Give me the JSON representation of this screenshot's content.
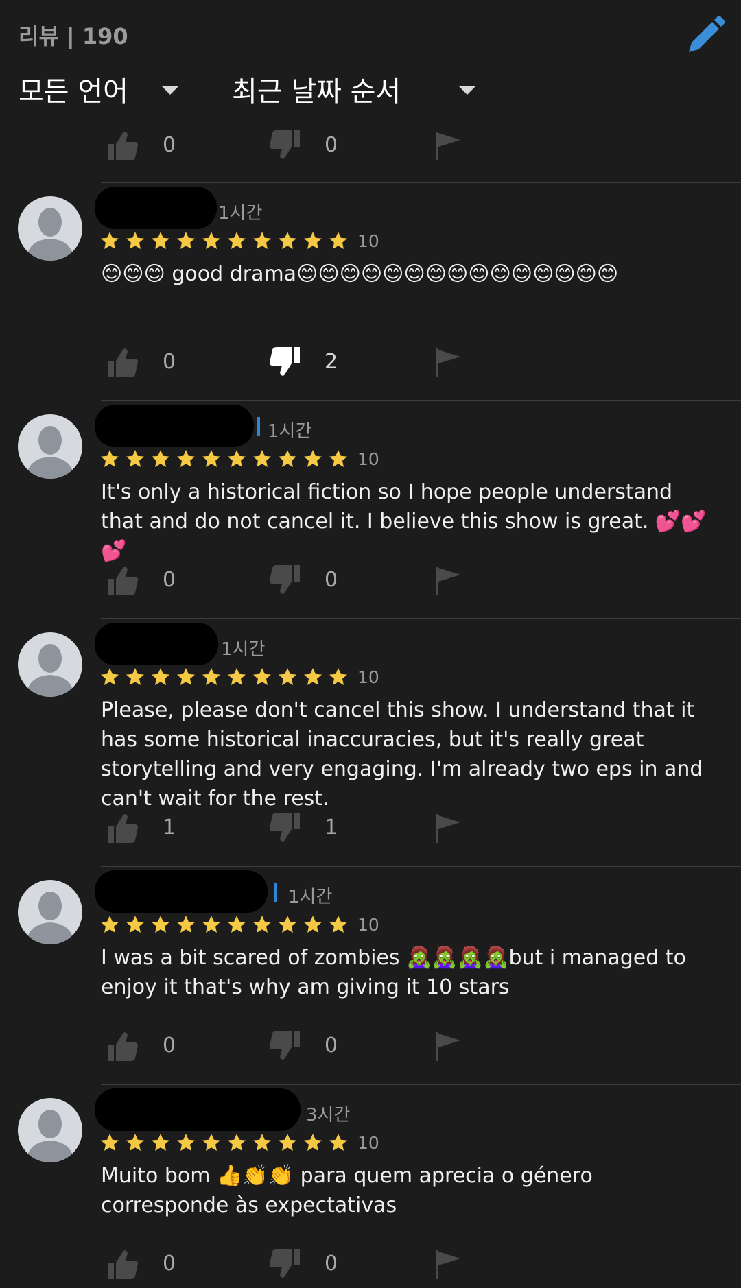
{
  "header": {
    "review_count_label": "리뷰 | 190",
    "edit_icon": "pencil-icon",
    "language_filter": "모든 언어",
    "sort_filter": "최근 날짜 순서"
  },
  "top_actions": {
    "likes": "0",
    "dislikes": "0"
  },
  "reviews": [
    {
      "time": "1시간",
      "rating_stars": 10,
      "score": "10",
      "text": "😊😊😊 good drama😊😊😊😊😊😊😊😊😊😊😊😊😊😊😊",
      "likes": "0",
      "dislikes": "2",
      "dislike_active": true
    },
    {
      "time": "1시간",
      "rating_stars": 10,
      "score": "10",
      "text": "It's only a historical fiction so I hope people understand that and do not cancel it. I believe this show is great. 💕💕💕",
      "likes": "0",
      "dislikes": "0",
      "dislike_active": false
    },
    {
      "time": "1시간",
      "rating_stars": 10,
      "score": "10",
      "text": "Please, please don't cancel this show. I understand that it has some historical inaccuracies, but it's really great storytelling and very engaging. I'm already two eps in and can't wait for the rest.",
      "likes": "1",
      "dislikes": "1",
      "dislike_active": false
    },
    {
      "time": "1시간",
      "rating_stars": 10,
      "score": "10",
      "text": "I was a bit scared of zombies 🧟‍♀️🧟‍♀️🧟‍♀️🧟‍♀️but i managed to enjoy it that's why am giving it 10 stars",
      "likes": "0",
      "dislikes": "0",
      "dislike_active": false
    },
    {
      "time": "3시간",
      "rating_stars": 10,
      "score": "10",
      "text": "Muito bom 👍👏👏 para quem aprecia o género corresponde às expectativas",
      "likes": "0",
      "dislikes": "0",
      "dislike_active": false
    }
  ],
  "colors": {
    "background": "#1c1c1c",
    "star": "#f6c945",
    "edit_icon": "#3a8fd8",
    "divider": "#3d3d3d",
    "icon_inactive": "#4a4a4a",
    "icon_active": "#ffffff"
  }
}
